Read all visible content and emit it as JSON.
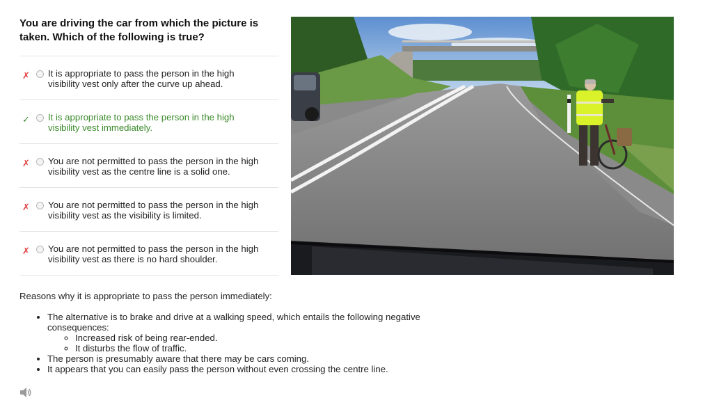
{
  "question": {
    "line1": "You are driving the car from which the picture is",
    "line2": "taken. Which of the following is true?"
  },
  "options": [
    {
      "mark": "✗",
      "status": "wrong",
      "line1": "It is appropriate to pass the person in the high",
      "line2": "visibility vest only after the curve up ahead."
    },
    {
      "mark": "✓",
      "status": "correct",
      "line1": "It is appropriate to pass the person in the high",
      "line2": "visibility vest immediately."
    },
    {
      "mark": "✗",
      "status": "wrong",
      "line1": "You are not permitted to pass the person in the high",
      "line2": "visibility vest as the centre line is a solid one."
    },
    {
      "mark": "✗",
      "status": "wrong",
      "line1": "You are not permitted to pass the person in the high",
      "line2": "visibility vest as the visibility is limited."
    },
    {
      "mark": "✗",
      "status": "wrong",
      "line1": "You are not permitted to pass the person in the high",
      "line2": "visibility vest as there is no hard shoulder."
    }
  ],
  "explanation": {
    "heading": "Reasons why it is appropriate to pass the person immediately:",
    "bullet1": "The alternative is to brake and drive at a walking speed, which entails the following negative consequences:",
    "sub1": "Increased risk of being rear-ended.",
    "sub2": "It disturbs the flow of traffic.",
    "bullet2": "The person is presumably aware that there may be cars coming.",
    "bullet3": "It appears that you can easily pass the person without even crossing the centre line."
  },
  "icons": {
    "audio": "speaker-icon",
    "wrong": "cross-mark-icon",
    "right": "check-mark-icon"
  },
  "colors": {
    "correct": "#3a8a2a",
    "wrong": "#e04040",
    "divider": "#e3e3e3"
  }
}
